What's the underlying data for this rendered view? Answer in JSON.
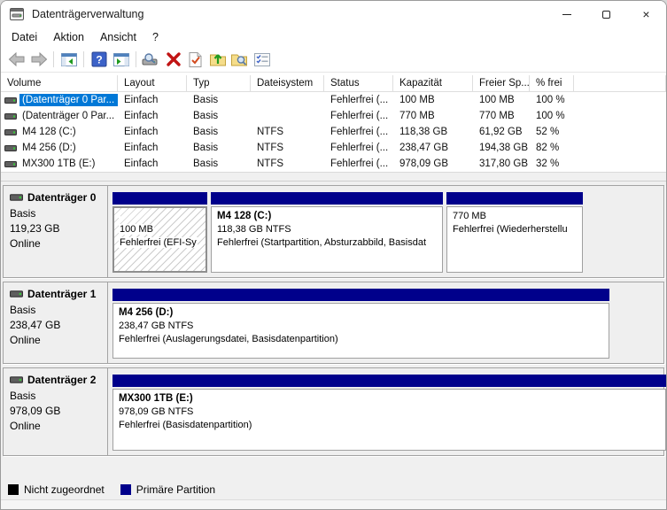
{
  "window": {
    "title": "Datenträgerverwaltung"
  },
  "titlebar_icons": [
    "app-disk-icon",
    "minimize-icon",
    "maximize-icon",
    "close-icon"
  ],
  "menu": {
    "items": [
      "Datei",
      "Aktion",
      "Ansicht",
      "?"
    ]
  },
  "toolbar": {
    "icons": [
      "back-icon",
      "forward-icon",
      "show-console-tree-icon",
      "help-icon",
      "show-action-pane-icon",
      "drive-search-icon",
      "delete-icon",
      "check-document-icon",
      "folder-up-icon",
      "folder-search-icon",
      "task-list-icon"
    ]
  },
  "table": {
    "columns": [
      "Volume",
      "Layout",
      "Typ",
      "Dateisystem",
      "Status",
      "Kapazität",
      "Freier Sp...",
      "% frei"
    ],
    "rows": [
      {
        "volume": "(Datenträger 0 Par...",
        "layout": "Einfach",
        "typ": "Basis",
        "dateisystem": "",
        "status": "Fehlerfrei (...",
        "kapazitaet": "100 MB",
        "freier_sp": "100 MB",
        "prozent_frei": "100 %",
        "selected": true
      },
      {
        "volume": "(Datenträger 0 Par...",
        "layout": "Einfach",
        "typ": "Basis",
        "dateisystem": "",
        "status": "Fehlerfrei (...",
        "kapazitaet": "770 MB",
        "freier_sp": "770 MB",
        "prozent_frei": "100 %",
        "selected": false
      },
      {
        "volume": "M4 128 (C:)",
        "layout": "Einfach",
        "typ": "Basis",
        "dateisystem": "NTFS",
        "status": "Fehlerfrei (...",
        "kapazitaet": "118,38 GB",
        "freier_sp": "61,92 GB",
        "prozent_frei": "52 %",
        "selected": false
      },
      {
        "volume": "M4 256 (D:)",
        "layout": "Einfach",
        "typ": "Basis",
        "dateisystem": "NTFS",
        "status": "Fehlerfrei (...",
        "kapazitaet": "238,47 GB",
        "freier_sp": "194,38 GB",
        "prozent_frei": "82 %",
        "selected": false
      },
      {
        "volume": "MX300 1TB (E:)",
        "layout": "Einfach",
        "typ": "Basis",
        "dateisystem": "NTFS",
        "status": "Fehlerfrei (...",
        "kapazitaet": "978,09 GB",
        "freier_sp": "317,80 GB",
        "prozent_frei": "32 %",
        "selected": false
      }
    ]
  },
  "disks": [
    {
      "name": "Datenträger 0",
      "type": "Basis",
      "size": "119,23 GB",
      "status": "Online",
      "partitions": [
        {
          "label": "",
          "size": "100 MB",
          "status": "Fehlerfrei (EFI-Sy",
          "selected": true
        },
        {
          "label": "M4 128  (C:)",
          "size": "118,38 GB NTFS",
          "status": "Fehlerfrei (Startpartition, Absturzabbild, Basisdat",
          "selected": false
        },
        {
          "label": "",
          "size": "770 MB",
          "status": "Fehlerfrei (Wiederherstellu",
          "selected": false
        }
      ]
    },
    {
      "name": "Datenträger 1",
      "type": "Basis",
      "size": "238,47 GB",
      "status": "Online",
      "partitions": [
        {
          "label": "M4 256  (D:)",
          "size": "238,47 GB NTFS",
          "status": "Fehlerfrei (Auslagerungsdatei, Basisdatenpartition)",
          "selected": false
        }
      ]
    },
    {
      "name": "Datenträger 2",
      "type": "Basis",
      "size": "978,09 GB",
      "status": "Online",
      "partitions": [
        {
          "label": "MX300 1TB  (E:)",
          "size": "978,09 GB NTFS",
          "status": "Fehlerfrei (Basisdatenpartition)",
          "selected": false
        }
      ]
    }
  ],
  "legend": {
    "items": [
      {
        "label": "Nicht zugeordnet",
        "color": "#000000"
      },
      {
        "label": "Primäre Partition",
        "color": "#00008B"
      }
    ]
  },
  "colors": {
    "selection": "#0078d7",
    "partition_bar": "#00008B",
    "panel_gray": "#f0f0f0"
  }
}
